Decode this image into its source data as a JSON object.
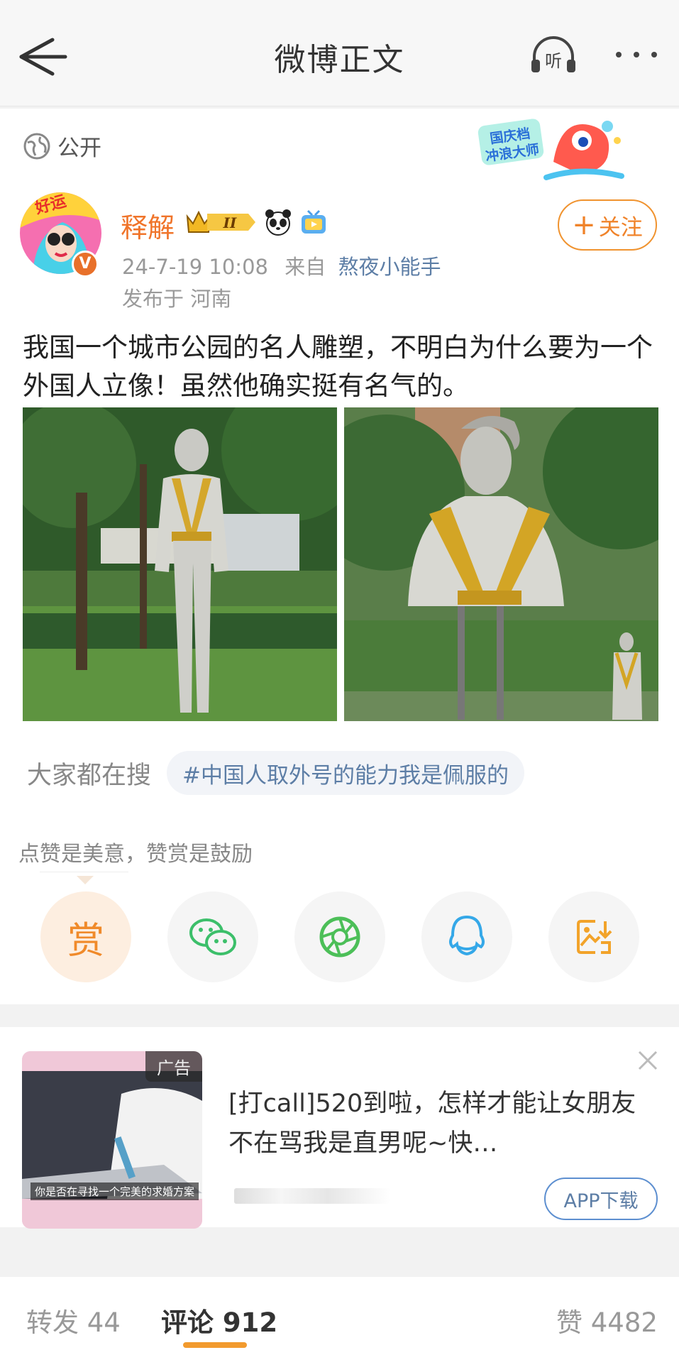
{
  "header": {
    "title": "微博正文",
    "listen_label": "听"
  },
  "post": {
    "visibility": "公开",
    "campaign_badge": "国庆档冲浪大师",
    "user": {
      "name": "释解",
      "level_badge": "II",
      "verify_mark": "V"
    },
    "meta": {
      "time": "24-7-19 10:08",
      "from_prefix": "来自",
      "source": "熬夜小能手"
    },
    "location": "发布于 河南",
    "follow_label": "关注",
    "text": "我国一个城市公园的名人雕塑，不明白为什么要为一个外国人立像！虽然他确实挺有名气的。",
    "search": {
      "label": "大家都在搜",
      "topic": "#中国人取外号的能力我是佩服的"
    },
    "reward_tip": "点赞是美意，赞赏是鼓励",
    "reward_label": "赏"
  },
  "ad": {
    "tag": "广告",
    "caption": "你是否在寻找一个完美的求婚方案",
    "text": "[打call]520到啦，怎样才能让女朋友不在骂我是直男呢~快…",
    "app_button": "APP下载"
  },
  "tabs": {
    "repost": "转发 44",
    "comments": "评论 912",
    "likes": "赞 4482"
  },
  "colors": {
    "accent": "#f0742a",
    "link": "#5d7ea6",
    "tab_indicator": "#f29a2e"
  }
}
